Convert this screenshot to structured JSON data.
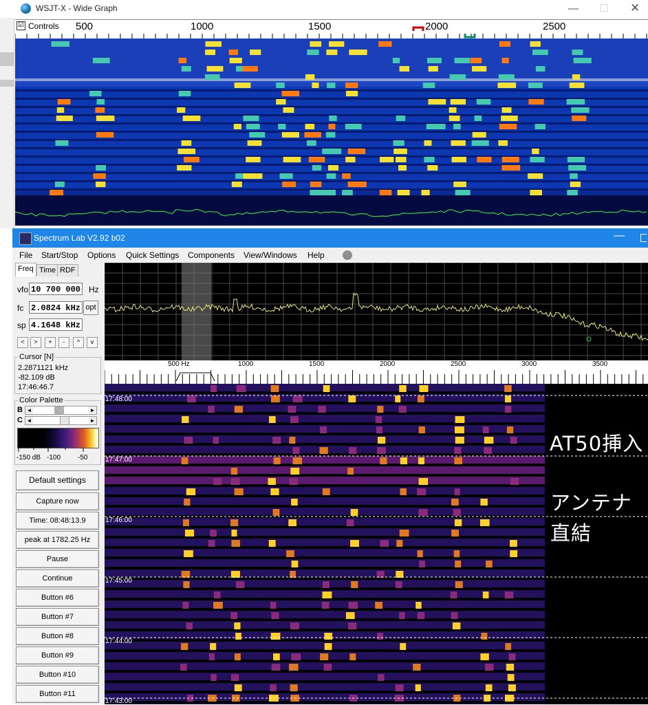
{
  "wsjt": {
    "title": "WSJT-X - Wide Graph",
    "controls_label": "Controls",
    "controls_checked": "☑",
    "scale_ticks": [
      "500",
      "1000",
      "1500",
      "2000",
      "2500"
    ]
  },
  "slab": {
    "title": "Spectrum Lab V2.92 b02",
    "menu": [
      "File",
      "Start/Stop",
      "Options",
      "Quick Settings",
      "Components",
      "View/Windows",
      "Help"
    ],
    "tabs": [
      "Freq",
      "Time",
      "RDF"
    ],
    "vfo": {
      "label": "vfo",
      "value": "10 700 000",
      "unit": "Hz"
    },
    "fc": {
      "label": "fc",
      "value": "2.0824 kHz",
      "button": "opt"
    },
    "sp": {
      "label": "sp",
      "value": "4.1648 kHz"
    },
    "nav_buttons": [
      "<",
      ">",
      "+",
      "-",
      "^",
      "v"
    ],
    "cursor": {
      "label": "Cursor [N]",
      "freq": "2.2871121 kHz",
      "level": "-82.109 dB",
      "time": "17:46:46.7"
    },
    "palette": {
      "label": "Color Palette",
      "b_label": "B",
      "c_label": "C",
      "scale_labels": [
        "-150 dB",
        "-100",
        "-50"
      ]
    },
    "buttons": [
      "Default settings",
      "Capture now",
      "Time:  08:48:13.9",
      "peak at 1782.25 Hz",
      "Pause",
      "Continue",
      "Button #6",
      "Button #7",
      "Button #8",
      "Button #9",
      "Button #10",
      "Button #11"
    ],
    "freq_ticks": [
      "500 Hz",
      "1000",
      "1500",
      "2000",
      "2500",
      "3000",
      "3500"
    ],
    "time_labels": [
      "17:48:00",
      "17:47:00",
      "17:46:00",
      "17:45:00",
      "17:44:00",
      "17:43:00"
    ],
    "overlay_text": [
      "AT50挿入",
      "アンテナ",
      "直結"
    ]
  }
}
